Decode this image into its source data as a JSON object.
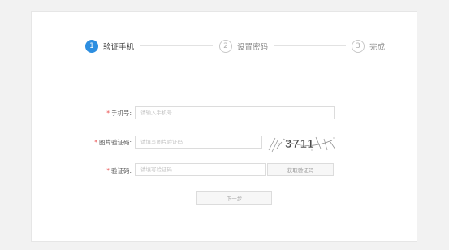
{
  "steps": [
    {
      "number": "1",
      "label": "验证手机",
      "state": "active"
    },
    {
      "number": "2",
      "label": "设置密码",
      "state": "inactive"
    },
    {
      "number": "3",
      "label": "完成",
      "state": "inactive"
    }
  ],
  "form": {
    "required_mark": "*",
    "phone": {
      "label": "手机号:",
      "placeholder": "请输入手机号",
      "value": ""
    },
    "image_code": {
      "label": "图片验证码:",
      "placeholder": "请填写图片验证码",
      "value": ""
    },
    "sms_code": {
      "label": "验证码:",
      "placeholder": "请填写验证码",
      "value": ""
    },
    "captcha_text": "3711",
    "get_code_button": "获取验证码",
    "next_button": "下一步"
  },
  "colors": {
    "accent": "#2d8ee0",
    "required": "#e84a4a"
  }
}
